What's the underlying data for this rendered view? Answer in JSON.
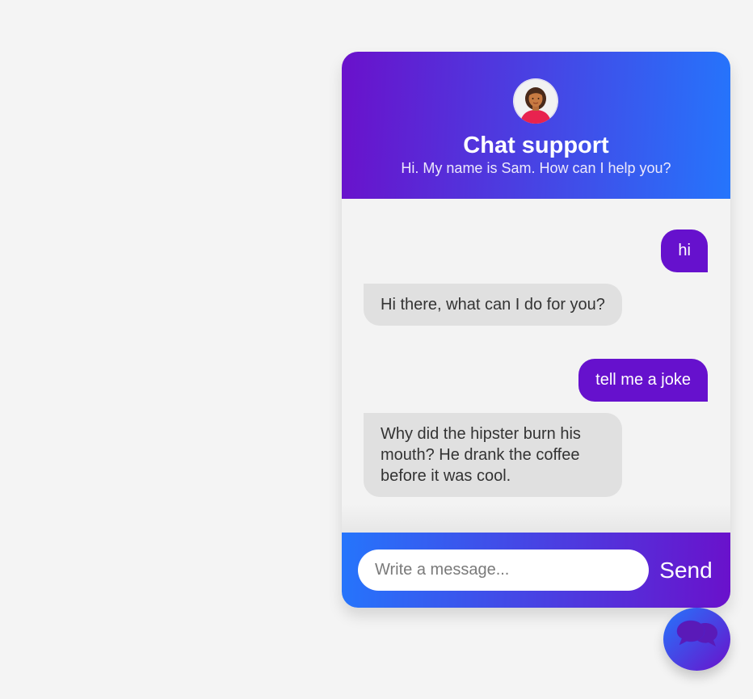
{
  "header": {
    "title": "Chat support",
    "subtitle": "Hi. My name is Sam. How can I help you?",
    "avatar_icon": "woman-avatar-icon"
  },
  "messages": [
    {
      "sender": "user",
      "text": "hi"
    },
    {
      "sender": "agent",
      "text": "Hi there, what can I do for you?"
    },
    {
      "sender": "user",
      "text": "tell me a joke"
    },
    {
      "sender": "agent",
      "text": "Why did the hipster burn his mouth? He drank the coffee before it was cool."
    }
  ],
  "footer": {
    "input_placeholder": "Write a message...",
    "input_value": "",
    "send_label": "Send"
  },
  "launcher": {
    "icon": "chat-bubbles-icon"
  },
  "colors": {
    "gradient_start": "#6a11cb",
    "gradient_end": "#2575fc",
    "user_bubble": "#6611cd",
    "agent_bubble": "#e0e0e0",
    "background": "#f4f4f4"
  }
}
